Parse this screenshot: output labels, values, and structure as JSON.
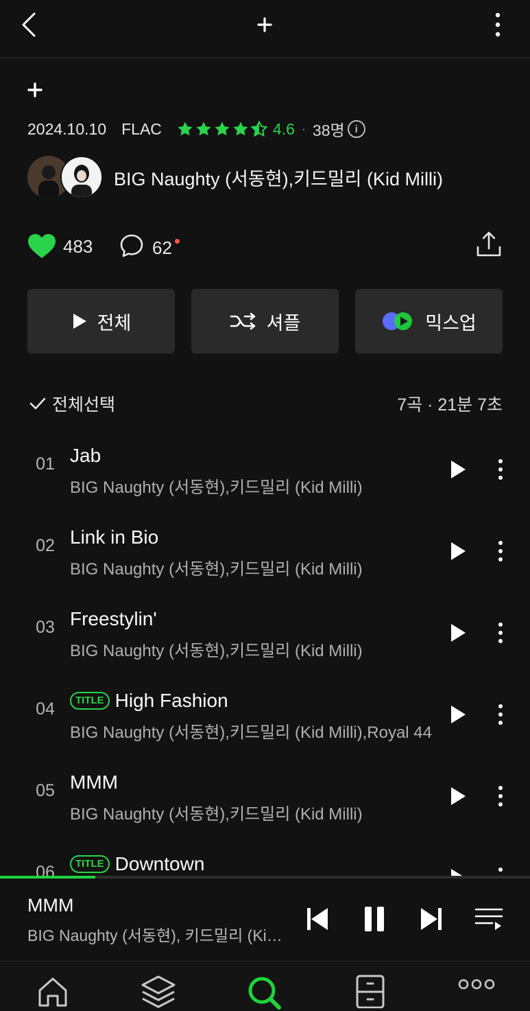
{
  "header": {
    "back_icon": "chevron-left-icon",
    "add_icon": "plus-icon",
    "menu_icon": "kebab-vertical-icon"
  },
  "album": {
    "add_symbol": "+",
    "date": "2024.10.10",
    "format": "FLAC",
    "rating_stars": 4.5,
    "rating": "4.6",
    "separator": "·",
    "rating_count": "38명",
    "artists": "BIG Naughty (서동현),키드밀리 (Kid Milli)"
  },
  "social": {
    "likes": "483",
    "comments": "62",
    "accent": "#2bd34a"
  },
  "buttons": {
    "play_all": "전체",
    "shuffle": "셔플",
    "mixup": "믹스업"
  },
  "selection": {
    "select_all": "전체선택",
    "summary": "7곡 · 21분 7초"
  },
  "tracks": [
    {
      "num": "01",
      "title": "Jab",
      "badge": "",
      "artist": "BIG Naughty (서동현),키드밀리 (Kid Milli)"
    },
    {
      "num": "02",
      "title": "Link in Bio",
      "badge": "",
      "artist": "BIG Naughty (서동현),키드밀리 (Kid Milli)"
    },
    {
      "num": "03",
      "title": "Freestylin'",
      "badge": "",
      "artist": "BIG Naughty (서동현),키드밀리 (Kid Milli)"
    },
    {
      "num": "04",
      "title": "High Fashion",
      "badge": "TITLE",
      "artist": "BIG Naughty (서동현),키드밀리 (Kid Milli),Royal 44"
    },
    {
      "num": "05",
      "title": "MMM",
      "badge": "",
      "artist": "BIG Naughty (서동현),키드밀리 (Kid Milli)"
    },
    {
      "num": "06",
      "title": "Downtown",
      "badge": "TITLE",
      "artist": ""
    }
  ],
  "now_playing": {
    "title": "MMM",
    "artist": "BIG Naughty (서동현), 키드밀리 (Kid Milli)",
    "progress": 0.18
  },
  "nav": [
    "home-icon",
    "library-layers-icon",
    "search-icon",
    "storage-box-icon",
    "more-dots-icon"
  ],
  "nav_active": "search-icon"
}
